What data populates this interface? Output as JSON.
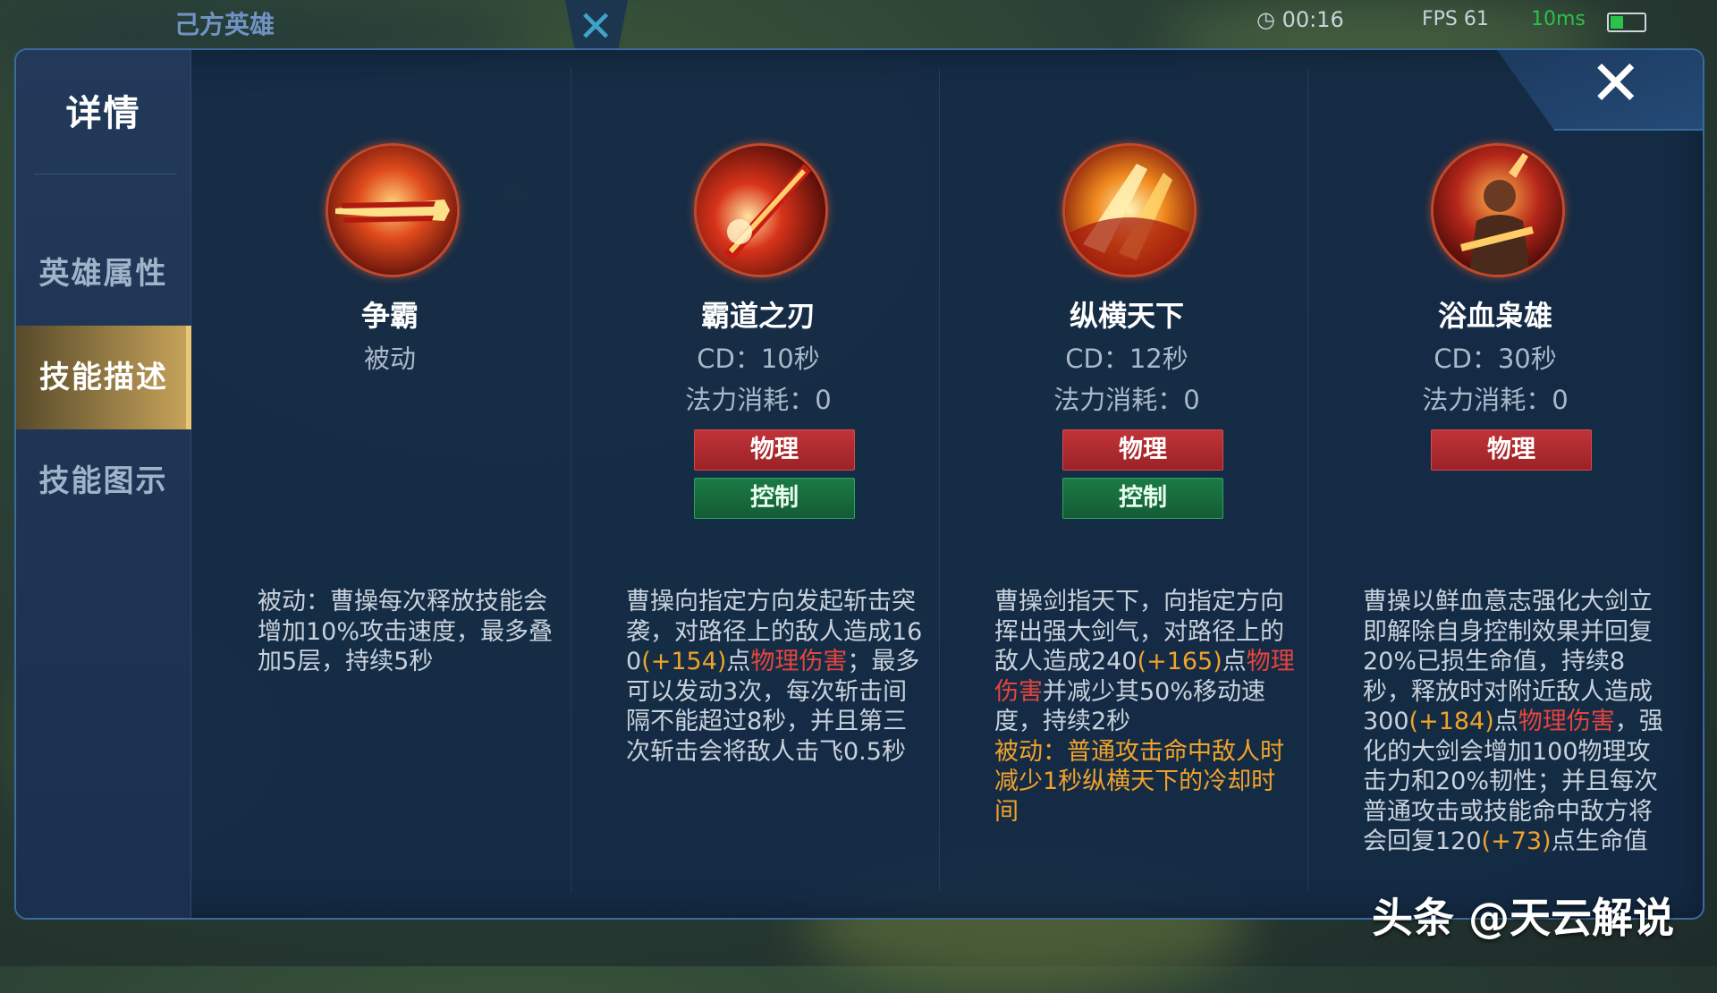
{
  "topbar": {
    "ally_label": "己方英雄",
    "timer": "00:16",
    "fps": "FPS 61",
    "ping": "10ms"
  },
  "sidebar": {
    "title": "详情",
    "items": [
      {
        "label": "英雄属性"
      },
      {
        "label": "技能描述"
      },
      {
        "label": "技能图示"
      }
    ],
    "active_index": 1
  },
  "close_label": "✕",
  "skills": [
    {
      "name": "争霸",
      "sub": "被动",
      "cost": "",
      "tags": [],
      "desc_parts": [
        {
          "t": "被动：曹操每次释放技能会增加10%攻击速度，最多叠加5层，持续5秒",
          "c": ""
        }
      ]
    },
    {
      "name": "霸道之刃",
      "sub": "CD：10秒",
      "cost": "法力消耗：0",
      "tags": [
        "物理",
        "控制"
      ],
      "desc_parts": [
        {
          "t": "曹操向指定方向发起斩击突袭，对路径上的敌人造成160",
          "c": ""
        },
        {
          "t": "(+154)",
          "c": "y"
        },
        {
          "t": "点",
          "c": ""
        },
        {
          "t": "物理伤害",
          "c": "r"
        },
        {
          "t": "；最多可以发动3次，每次斩击间隔不能超过8秒，并且第三次斩击会将敌人击飞0.5秒",
          "c": ""
        }
      ]
    },
    {
      "name": "纵横天下",
      "sub": "CD：12秒",
      "cost": "法力消耗：0",
      "tags": [
        "物理",
        "控制"
      ],
      "desc_parts": [
        {
          "t": "曹操剑指天下，向指定方向挥出强大剑气，对路径上的敌人造成240",
          "c": ""
        },
        {
          "t": "(+165)",
          "c": "y"
        },
        {
          "t": "点",
          "c": ""
        },
        {
          "t": "物理伤害",
          "c": "r"
        },
        {
          "t": "并减少其50%移动速度，持续2秒",
          "c": ""
        },
        {
          "t": "被动：普通攻击命中敌人时减少1秒纵横天下的冷却时间",
          "c": "y",
          "block": true
        }
      ]
    },
    {
      "name": "浴血枭雄",
      "sub": "CD：30秒",
      "cost": "法力消耗：0",
      "tags": [
        "物理"
      ],
      "desc_parts": [
        {
          "t": "曹操以鲜血意志强化大剑立即解除自身控制效果并回复20%已损生命值，持续8秒，释放时对附近敌人造成300",
          "c": ""
        },
        {
          "t": "(+184)",
          "c": "y"
        },
        {
          "t": "点",
          "c": ""
        },
        {
          "t": "物理伤害",
          "c": "r"
        },
        {
          "t": "，强化的大剑会增加100物理攻击力和20%韧性；并且每次普通攻击或技能命中敌方将会回复120",
          "c": ""
        },
        {
          "t": "(+73)",
          "c": "y"
        },
        {
          "t": "点生命值",
          "c": ""
        }
      ]
    }
  ],
  "watermark": "头条 @天云解说",
  "colors": {
    "panel": "#142a46",
    "accent_gold": "#c9a55a",
    "tag_physical": "#c13338",
    "tag_control": "#1b7a45",
    "bonus_yellow": "#f0a32a",
    "damage_red": "#e5453c"
  }
}
